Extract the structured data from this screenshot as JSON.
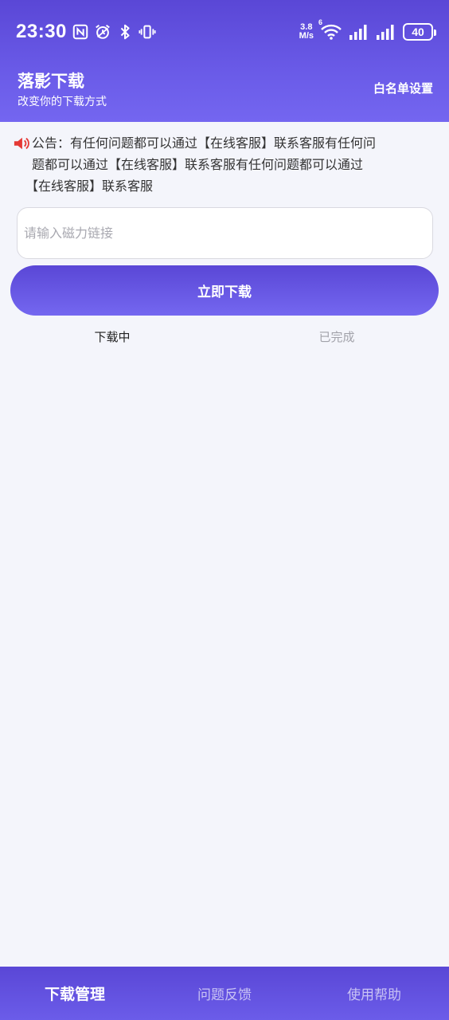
{
  "status_bar": {
    "time": "23:30",
    "net_speed_value": "3.8",
    "net_speed_unit": "M/s",
    "wifi_badge": "6",
    "battery": "40",
    "icons": [
      "nfc-icon",
      "alarm-icon",
      "bluetooth-icon",
      "vibrate-icon",
      "wifi-icon",
      "signal-icon",
      "signal-icon",
      "battery-icon"
    ]
  },
  "app_bar": {
    "title": "落影下载",
    "subtitle": "改变你的下载方式",
    "whitelist_label": "白名单设置"
  },
  "notice": {
    "icon": "speaker-icon",
    "line1": "公告：有任何问题都可以通过【在线客服】联系客服有任何问",
    "line2": "题都可以通过【在线客服】联系客服有任何问题都可以通过",
    "line3": "【在线客服】联系客服"
  },
  "input": {
    "value": "",
    "placeholder": "请输入磁力链接"
  },
  "download_button": {
    "label": "立即下载"
  },
  "tabs": [
    {
      "label": "下载中",
      "active": true
    },
    {
      "label": "已完成",
      "active": false
    }
  ],
  "bottom_nav": [
    {
      "label": "下载管理",
      "active": true
    },
    {
      "label": "问题反馈",
      "active": false
    },
    {
      "label": "使用帮助",
      "active": false
    }
  ],
  "colors": {
    "primary": "#5a47d6",
    "primary_light": "#7466f0",
    "background": "#f4f5fb",
    "notice_icon": "#e53935"
  }
}
